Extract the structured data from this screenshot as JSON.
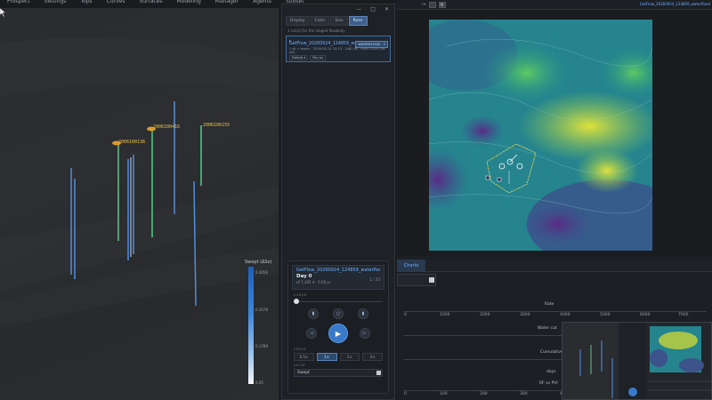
{
  "menubar": {
    "items": [
      "Prospect",
      "Settings",
      "Tops",
      "Curves",
      "Surfaces",
      "Modeling",
      "Manager",
      "Agents",
      "Subset"
    ]
  },
  "viewport": {
    "well_labels": [
      "2006100136",
      "2006100416",
      "2006106155"
    ],
    "legend": {
      "title": "Swept (ΔSo)",
      "ticks": [
        "0.4456",
        "0.3078",
        "0.1789",
        "0.05"
      ]
    }
  },
  "panel": {
    "window_controls": [
      "—",
      "□",
      "✕"
    ],
    "tabs": [
      "Display",
      "Color",
      "Size",
      "Runs"
    ],
    "active_tab": "Runs",
    "hint": "1 run(s) for the staged flowbody",
    "run": {
      "name": "GetFlow_20260924_124859_waterflood",
      "meta": "1 sit + water · 2026-09-24 15:13 · 1462.8s · multi 0.459 (fw eff)",
      "badge": "WATERFLOOD · 2",
      "buttons": [
        "Details ▾",
        "Re-run"
      ]
    },
    "player": {
      "title": "GetFlow_20260924_124859_waterfloo",
      "day": "Day 0",
      "sub": "of 7,305 d · 0.00 yr",
      "count": "1 / 23",
      "scrub_label": "SCRUB",
      "speed_label": "SPEED",
      "speeds": [
        "0.5×",
        "1×",
        "2×",
        "4×"
      ],
      "active_speed": "1×",
      "show_label": "SHOW",
      "show_value": "Swept",
      "footer": "· · · · · · · ·"
    }
  },
  "right": {
    "toolbar_label": "re",
    "toolbar_btn2": "fit",
    "flow_title": "GetFlow_20260924_124859_waterflood",
    "charts_tab": "Charts",
    "charts": [
      {
        "title": "Rate",
        "ticks": [
          "0",
          "1000",
          "2000",
          "3000",
          "4000",
          "5000",
          "6000",
          "7000"
        ]
      },
      {
        "title": "Water cut",
        "ticks": []
      },
      {
        "title": "Cumulative",
        "ticks": []
      },
      {
        "title": "days",
        "ticks": []
      },
      {
        "title": "RF vs PVI",
        "ticks": [
          "0",
          "100",
          "200",
          "300",
          "400"
        ]
      }
    ]
  },
  "colors": {
    "accent": "#3a79c9",
    "well_label": "#f0c24a",
    "legend_high": "#1f5fb8",
    "legend_low": "#f4f7fb"
  }
}
